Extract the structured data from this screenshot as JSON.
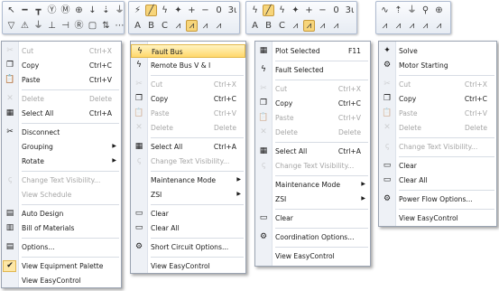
{
  "palettes": [
    {
      "row1": [
        {
          "name": "pointer-icon",
          "glyph": "↖"
        },
        {
          "name": "bus-icon",
          "glyph": "━"
        },
        {
          "name": "transformer-tee-icon",
          "glyph": "┳"
        },
        {
          "name": "generator-icon",
          "glyph": "Ⓨ"
        },
        {
          "name": "motor-icon",
          "glyph": "Ⓜ"
        },
        {
          "name": "load-icon",
          "glyph": "⊕"
        },
        {
          "name": "switch-icon",
          "glyph": "↓"
        },
        {
          "name": "cable-icon",
          "glyph": "⇣"
        },
        {
          "name": "breaker-icon",
          "glyph": "⏚"
        },
        {
          "name": "more-icon",
          "glyph": "▾"
        }
      ],
      "row2": [
        {
          "name": "filter-icon",
          "glyph": "▽"
        },
        {
          "name": "hazard-icon",
          "glyph": "⚠"
        },
        {
          "name": "ground-icon",
          "glyph": "⏚"
        },
        {
          "name": "shunt-icon",
          "glyph": "⊥"
        },
        {
          "name": "capacitor-icon",
          "glyph": "⊣"
        },
        {
          "name": "meter-icon",
          "glyph": "Ⓡ"
        },
        {
          "name": "panel-icon",
          "glyph": "▢"
        },
        {
          "name": "arrows-icon",
          "glyph": "⇅"
        },
        {
          "name": "dots-icon",
          "glyph": "⋯"
        }
      ]
    },
    {
      "row1": [
        {
          "name": "short-circuit-icon",
          "glyph": "⚡"
        },
        {
          "name": "fault-bus-icon",
          "glyph": "╱",
          "active": true
        },
        {
          "name": "flash-icon",
          "glyph": "ϟ"
        },
        {
          "name": "motor-start-icon",
          "glyph": "✦"
        },
        {
          "name": "plus-icon",
          "glyph": "+"
        },
        {
          "name": "minus-icon",
          "glyph": "−"
        },
        {
          "name": "zero-seq-icon",
          "glyph": "0"
        },
        {
          "name": "three-phase-icon",
          "glyph": "3ι"
        }
      ],
      "row2": [
        {
          "name": "phase-a-icon",
          "glyph": "A"
        },
        {
          "name": "phase-b-icon",
          "glyph": "B"
        },
        {
          "name": "phase-c-icon",
          "glyph": "C"
        },
        {
          "name": "hatch1-icon",
          "glyph": "⩘"
        },
        {
          "name": "hatch2-icon",
          "glyph": "⩘",
          "active": true
        },
        {
          "name": "hatch3-icon",
          "glyph": "⩘"
        },
        {
          "name": "hatch4-icon",
          "glyph": "⩘"
        }
      ]
    },
    {
      "row1": [
        {
          "name": "flash-icon",
          "glyph": "ϟ"
        },
        {
          "name": "plot-icon",
          "glyph": "╱",
          "active": true
        },
        {
          "name": "flash2-icon",
          "glyph": "ϟ"
        },
        {
          "name": "motor-start-icon",
          "glyph": "✦"
        },
        {
          "name": "plus-icon",
          "glyph": "+"
        },
        {
          "name": "minus-icon",
          "glyph": "−"
        },
        {
          "name": "zero-seq-icon",
          "glyph": "0"
        },
        {
          "name": "three-phase-icon",
          "glyph": "3ι"
        }
      ],
      "row2": [
        {
          "name": "phase-a-icon",
          "glyph": "A"
        },
        {
          "name": "phase-b-icon",
          "glyph": "B"
        },
        {
          "name": "phase-c-icon",
          "glyph": "C"
        },
        {
          "name": "hatch1-icon",
          "glyph": "⩘"
        },
        {
          "name": "hatch2-icon",
          "glyph": "⩘",
          "active": true
        },
        {
          "name": "hatch3-icon",
          "glyph": "⩘"
        },
        {
          "name": "hatch4-icon",
          "glyph": "⩘"
        }
      ]
    },
    {
      "row1": [
        {
          "name": "wave-icon",
          "glyph": "∿"
        },
        {
          "name": "loadflow-icon",
          "glyph": "⇡"
        },
        {
          "name": "ground-icon",
          "glyph": "⏚"
        },
        {
          "name": "search-icon",
          "glyph": "⚲"
        },
        {
          "name": "zoom-icon",
          "glyph": "⊕"
        }
      ],
      "row2": [
        {
          "name": "hatch1-icon",
          "glyph": "⩘"
        },
        {
          "name": "hatch2-icon",
          "glyph": "⩘"
        },
        {
          "name": "hatch3-icon",
          "glyph": "⩘"
        },
        {
          "name": "hatch4-icon",
          "glyph": "⩘"
        },
        {
          "name": "hatch5-icon",
          "glyph": "⩘"
        }
      ]
    }
  ],
  "menus": {
    "edit": {
      "items": [
        {
          "label": "Cut",
          "shortcut": "Ctrl+X",
          "icon": "scissors-icon",
          "glyph": "✂",
          "disabled": true
        },
        {
          "label": "Copy",
          "shortcut": "Ctrl+C",
          "icon": "copy-icon",
          "glyph": "❐"
        },
        {
          "label": "Paste",
          "shortcut": "Ctrl+V",
          "icon": "paste-icon",
          "glyph": "📋"
        },
        {
          "sep": true
        },
        {
          "label": "Delete",
          "shortcut": "Delete",
          "icon": "delete-icon",
          "glyph": "✕",
          "disabled": true
        },
        {
          "label": "Select All",
          "shortcut": "Ctrl+A",
          "icon": "select-all-icon",
          "glyph": "▦"
        },
        {
          "sep": true
        },
        {
          "label": "Disconnect",
          "icon": "disconnect-icon",
          "glyph": "✂"
        },
        {
          "label": "Grouping",
          "submenu": true
        },
        {
          "label": "Rotate",
          "submenu": true
        },
        {
          "sep": true
        },
        {
          "label": "Change Text Visibility...",
          "icon": "text-visibility-icon",
          "glyph": "ꞔ",
          "disabled": true
        },
        {
          "label": "View Schedule",
          "disabled": true
        },
        {
          "sep": true
        },
        {
          "label": "Auto Design",
          "icon": "auto-design-icon",
          "glyph": "▤"
        },
        {
          "label": "Bill of Materials",
          "icon": "bill-of-materials-icon",
          "glyph": "▥"
        },
        {
          "sep": true
        },
        {
          "label": "Options...",
          "icon": "options-icon",
          "glyph": "▤"
        },
        {
          "sep": true
        },
        {
          "label": "View Equipment Palette",
          "checked": true,
          "icon": "checkmark-icon",
          "glyph": "✔"
        },
        {
          "label": "View EasyControl"
        }
      ]
    },
    "fault": {
      "items": [
        {
          "label": "Fault Bus",
          "icon": "fault-bus-icon",
          "glyph": "ϟ",
          "highlight": true
        },
        {
          "label": "Remote Bus V & I",
          "icon": "remote-bus-icon",
          "glyph": "ϟ"
        },
        {
          "sep": true
        },
        {
          "label": "Cut",
          "shortcut": "Ctrl+X",
          "icon": "scissors-icon",
          "glyph": "✂",
          "disabled": true
        },
        {
          "label": "Copy",
          "shortcut": "Ctrl+C",
          "icon": "copy-icon",
          "glyph": "❐"
        },
        {
          "label": "Paste",
          "shortcut": "Ctrl+V",
          "icon": "paste-icon",
          "glyph": "📋",
          "disabled": true
        },
        {
          "label": "Delete",
          "shortcut": "Delete",
          "icon": "delete-icon",
          "glyph": "✕",
          "disabled": true
        },
        {
          "sep": true
        },
        {
          "label": "Select All",
          "shortcut": "Ctrl+A",
          "icon": "select-all-icon",
          "glyph": "▦"
        },
        {
          "label": "Change Text Visibility...",
          "icon": "text-visibility-icon",
          "glyph": "ꞔ",
          "disabled": true
        },
        {
          "sep": true
        },
        {
          "label": "Maintenance Mode",
          "submenu": true
        },
        {
          "label": "ZSI",
          "submenu": true
        },
        {
          "sep": true
        },
        {
          "label": "Clear",
          "icon": "clear-icon",
          "glyph": "▭"
        },
        {
          "label": "Clear All",
          "icon": "clear-all-icon",
          "glyph": "▭"
        },
        {
          "sep": true
        },
        {
          "label": "Short Circuit Options...",
          "icon": "options-icon",
          "glyph": "⚙"
        },
        {
          "sep": true
        },
        {
          "label": "View EasyControl"
        }
      ]
    },
    "plot": {
      "items": [
        {
          "label": "Plot Selected",
          "shortcut": "F11",
          "icon": "plot-icon",
          "glyph": "▦"
        },
        {
          "sep": true
        },
        {
          "label": "Fault Selected",
          "icon": "fault-selected-icon",
          "glyph": "ϟ"
        },
        {
          "sep": true
        },
        {
          "label": "Cut",
          "shortcut": "Ctrl+X",
          "icon": "scissors-icon",
          "glyph": "✂",
          "disabled": true
        },
        {
          "label": "Copy",
          "shortcut": "Ctrl+C",
          "icon": "copy-icon",
          "glyph": "❐"
        },
        {
          "label": "Paste",
          "shortcut": "Ctrl+V",
          "icon": "paste-icon",
          "glyph": "📋",
          "disabled": true
        },
        {
          "label": "Delete",
          "shortcut": "Delete",
          "icon": "delete-icon",
          "glyph": "✕",
          "disabled": true
        },
        {
          "sep": true
        },
        {
          "label": "Select All",
          "shortcut": "Ctrl+A",
          "icon": "select-all-icon",
          "glyph": "▦"
        },
        {
          "label": "Change Text Visibility...",
          "icon": "text-visibility-icon",
          "glyph": "ꞔ",
          "disabled": true
        },
        {
          "sep": true
        },
        {
          "label": "Maintenance Mode",
          "submenu": true
        },
        {
          "label": "ZSI",
          "submenu": true
        },
        {
          "sep": true
        },
        {
          "label": "Clear",
          "icon": "clear-icon",
          "glyph": "▭"
        },
        {
          "sep": true
        },
        {
          "label": "Coordination Options...",
          "icon": "options-icon",
          "glyph": "⚙"
        },
        {
          "sep": true
        },
        {
          "label": "View EasyControl"
        }
      ]
    },
    "flow": {
      "items": [
        {
          "label": "Solve",
          "icon": "solve-icon",
          "glyph": "✦"
        },
        {
          "label": "Motor Starting",
          "icon": "motor-starting-icon",
          "glyph": "⚙"
        },
        {
          "sep": true
        },
        {
          "label": "Cut",
          "shortcut": "Ctrl+X",
          "icon": "scissors-icon",
          "glyph": "✂",
          "disabled": true
        },
        {
          "label": "Copy",
          "shortcut": "Ctrl+C",
          "icon": "copy-icon",
          "glyph": "❐"
        },
        {
          "label": "Paste",
          "shortcut": "Ctrl+V",
          "icon": "paste-icon",
          "glyph": "📋",
          "disabled": true
        },
        {
          "label": "Delete",
          "shortcut": "Delete",
          "icon": "delete-icon",
          "glyph": "✕",
          "disabled": true
        },
        {
          "sep": true
        },
        {
          "label": "Change Text Visibility...",
          "icon": "text-visibility-icon",
          "glyph": "ꞔ",
          "disabled": true
        },
        {
          "sep": true
        },
        {
          "label": "Clear",
          "icon": "clear-icon",
          "glyph": "▭"
        },
        {
          "label": "Clear All",
          "icon": "clear-all-icon",
          "glyph": "▭"
        },
        {
          "sep": true
        },
        {
          "label": "Power Flow Options...",
          "icon": "options-icon",
          "glyph": "⚙"
        },
        {
          "sep": true
        },
        {
          "label": "View EasyControl"
        }
      ]
    }
  }
}
